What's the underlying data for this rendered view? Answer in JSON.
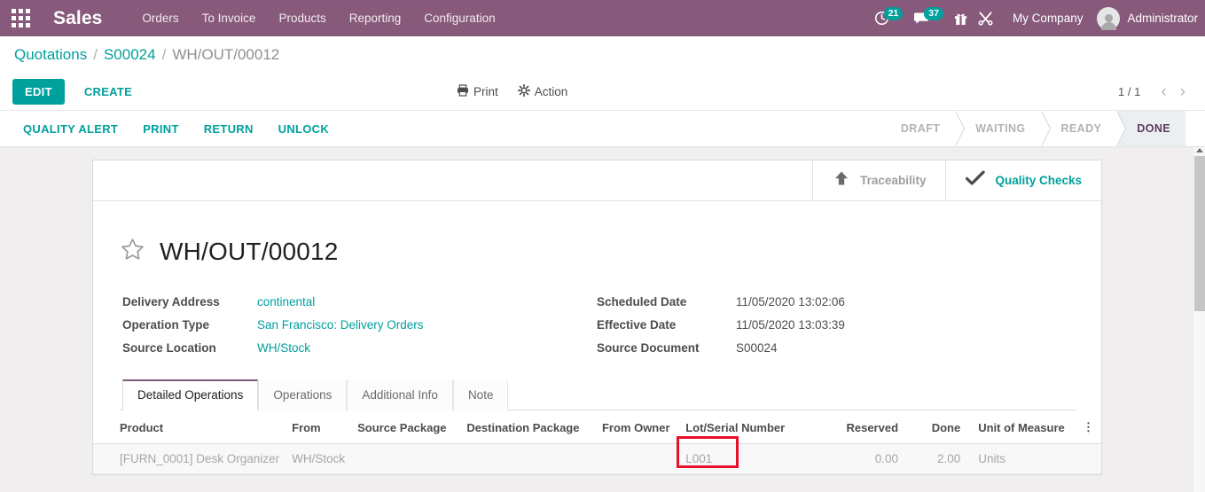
{
  "navbar": {
    "apps_icon": "apps-grid-icon",
    "brand": "Sales",
    "menus": [
      {
        "label": "Orders"
      },
      {
        "label": "To Invoice"
      },
      {
        "label": "Products"
      },
      {
        "label": "Reporting"
      },
      {
        "label": "Configuration"
      }
    ],
    "activity_icon": "clock-icon",
    "activity_count": "21",
    "messages_icon": "chat-icon",
    "messages_count": "37",
    "gift_icon": "gift-icon",
    "tools_icon": "tools-icon",
    "company": "My Company",
    "user": "Administrator",
    "accent_color": "#875A7B"
  },
  "breadcrumb": {
    "root": "Quotations",
    "parent": "S00024",
    "current": "WH/OUT/00012",
    "separator": "/"
  },
  "controls": {
    "edit_label": "EDIT",
    "create_label": "CREATE",
    "print_label": "Print",
    "action_label": "Action",
    "print_icon": "printer-icon",
    "action_icon": "gear-icon",
    "pager_count": "1 / 1",
    "prev_icon": "chevron-left-icon",
    "next_icon": "chevron-right-icon"
  },
  "statusbar": {
    "buttons": [
      {
        "label": "QUALITY ALERT"
      },
      {
        "label": "PRINT"
      },
      {
        "label": "RETURN"
      },
      {
        "label": "UNLOCK"
      }
    ],
    "stages": [
      {
        "label": "DRAFT",
        "active": false
      },
      {
        "label": "WAITING",
        "active": false
      },
      {
        "label": "READY",
        "active": false
      },
      {
        "label": "DONE",
        "active": true
      }
    ],
    "accent_color": "#00A09D",
    "active_stage_color": "#5D3C5A"
  },
  "smart_buttons": [
    {
      "label": "Traceability",
      "icon": "arrow-up-icon",
      "style": "gray"
    },
    {
      "label": "Quality Checks",
      "icon": "check-icon",
      "style": "teal"
    }
  ],
  "record": {
    "title": "WH/OUT/00012",
    "favorite_icon": "star-outline-icon",
    "fields_left": [
      {
        "label": "Delivery Address",
        "value": "continental",
        "is_link": true
      },
      {
        "label": "Operation Type",
        "value": "San Francisco: Delivery Orders",
        "is_link": true
      },
      {
        "label": "Source Location",
        "value": "WH/Stock",
        "is_link": true
      }
    ],
    "fields_right": [
      {
        "label": "Scheduled Date",
        "value": "11/05/2020 13:02:06",
        "is_link": false
      },
      {
        "label": "Effective Date",
        "value": "11/05/2020 13:03:39",
        "is_link": false
      },
      {
        "label": "Source Document",
        "value": "S00024",
        "is_link": false
      }
    ]
  },
  "notebook": {
    "tabs": [
      {
        "label": "Detailed Operations",
        "active": true
      },
      {
        "label": "Operations",
        "active": false
      },
      {
        "label": "Additional Info",
        "active": false
      },
      {
        "label": "Note",
        "active": false
      }
    ]
  },
  "table": {
    "columns": [
      "Product",
      "From",
      "Source Package",
      "Destination Package",
      "From Owner",
      "Lot/Serial Number",
      "Reserved",
      "Done",
      "Unit of Measure"
    ],
    "optional_col_icon": "vertical-dots-icon",
    "rows": [
      {
        "product": "[FURN_0001] Desk Organizer",
        "from": "WH/Stock",
        "source_package": "",
        "destination_package": "",
        "from_owner": "",
        "lot_serial": "L001",
        "reserved": "0.00",
        "done": "2.00",
        "uom": "Units"
      }
    ]
  },
  "annotation": {
    "highlight_target": "L001",
    "highlight_color": "#e8112d"
  },
  "scrollbar": {
    "up_arrow_icon": "caret-up-icon"
  }
}
